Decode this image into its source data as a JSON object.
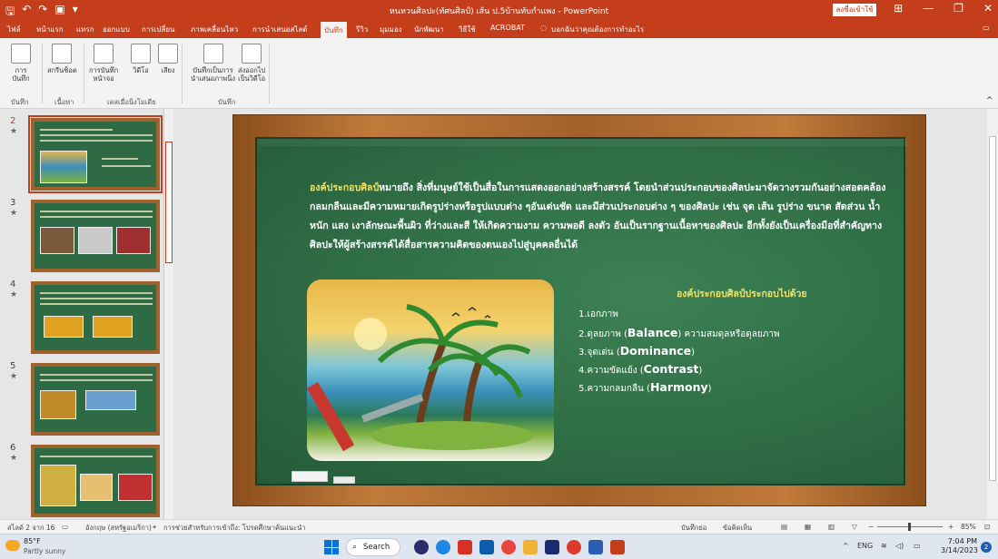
{
  "window": {
    "title": "หนหวนศิลปะ(ทัศนศิลป์) เส้น ป.5บ้านทับกำแพง  -  PowerPoint",
    "signin_label": "ลงชื่อเข้าใช้",
    "minimize": "—",
    "restore": "❐",
    "close": "✕",
    "ribbon_display": "⊞"
  },
  "quick_access": {
    "save": "🖫",
    "undo": "↶",
    "redo": "↷",
    "present": "▣",
    "more": "▾"
  },
  "tabs": [
    "ไฟล์",
    "หน้าแรก",
    "แทรก",
    "ออกแบบ",
    "การเปลี่ยน",
    "ภาพเคลื่อนไหว",
    "การนำเสนอสไลด์",
    "บันทึก",
    "รีวิว",
    "มุมมอง",
    "นักพัฒนา",
    "วิธีใช้",
    "ACROBAT"
  ],
  "tell_me": "บอกฉันว่าคุณต้องการทำอะไร",
  "ribbon": {
    "record_label": "การ\nบันทึก",
    "snapshot_label": "สกรีนช็อต",
    "screen_record_label": "การบันทึก\nหน้าจอ",
    "video_label": "วิดีโอ",
    "audio_label": "เสียง",
    "save_as_show_label": "บันทึกเป็นการ\nนำเสนอภาพนิ่ง",
    "export_video_label": "ส่งออกไป\nเป็นวิดีโอ",
    "group_record": "บันทึก",
    "group_content": "เนื้อหา",
    "group_media": "เดสเมื่อนิ่งโมเดีย",
    "group_save": "บันทึก"
  },
  "thumbnails": [
    {
      "num": "2",
      "star": "★"
    },
    {
      "num": "3",
      "star": "★"
    },
    {
      "num": "4",
      "star": "★"
    },
    {
      "num": "5",
      "star": "★"
    },
    {
      "num": "6",
      "star": "★"
    }
  ],
  "slide": {
    "para_highlight": "องค์ประกอบศิลป์",
    "para_rest": "หมายถึง สิ่งที่มนุษย์ใช้เป็นสื่อในการแสดงออกอย่างสร้างสรรค์ โดยนำส่วนประกอบของศิลปะมาจัดวางรวมกันอย่างสอดคล้องกลมกลืนและมีความหมายเกิดรูปร่างหรือรูปแบบต่าง ๆอันเด่นชัด และมีส่วนประกอบต่าง ๆ ของศิลปะ เช่น จุด เส้น รูปร่าง ขนาด สัดส่วน น้ำหนัก แสง เงาลักษณะพื้นผิว ที่ว่างและสี ให้เกิดความงาม ความพอดี ลงตัว อันเป็นรากฐานเนื้อหาของศิลปะ อีกทั้งยังเป็นเครื่องมือที่สำคัญทางศิลปะให้ผู้สร้างสรรค์ได้สื่อสารความคิดของตนเองไปสู่บุคคลอื่นได้",
    "list_heading": "องค์ประกอบศิลป์ประกอบไปด้วย",
    "items": [
      {
        "text": "1.เอกภาพ",
        "en": ""
      },
      {
        "text": "2.ดุลยภาพ (",
        "en": "Balance",
        "tail": ") ความสมดุลหรือดุลยภาพ"
      },
      {
        "text": " 3.จุดเด่น (",
        "en": "Dominance",
        "tail": ")"
      },
      {
        "text": "4.ความขัดแย้ง (",
        "en": "Contrast",
        "tail": ")"
      },
      {
        "text": "5.ความกลมกลืน (",
        "en": "Harmony",
        "tail": ")"
      }
    ]
  },
  "statusbar": {
    "slide_info": "สไลด์ 2 จาก 16",
    "language": "อังกฤษ (สหรัฐอเมริกา)",
    "accessibility": "การช่วยสำหรับการเข้าถึง: โปรดศึกษาค้นแนะนำ",
    "notes": "บันทึกย่อ",
    "comments": "ข้อคิดเห็น",
    "zoom": "85%",
    "zoom_minus": "−",
    "zoom_plus": "+"
  },
  "taskbar": {
    "temp": "85°F",
    "weather": "Partly sunny",
    "search": "Search",
    "lang": "ENG",
    "time": "7:04 PM",
    "date": "3/14/2023",
    "notif": "2"
  },
  "colors": {
    "accent": "#c43e1c",
    "board": "#2f6d45",
    "frame": "#a3612a",
    "highlight": "#f2e266"
  }
}
